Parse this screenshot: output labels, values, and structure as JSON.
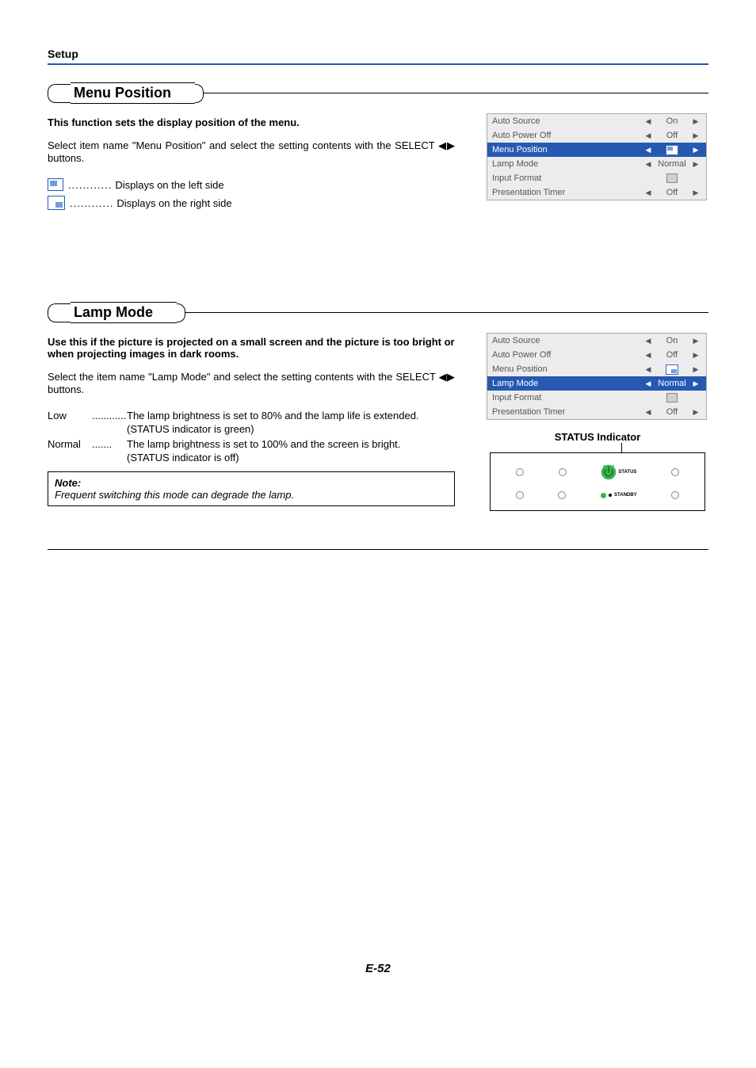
{
  "header": {
    "section": "Setup"
  },
  "menu_position": {
    "title": "Menu Position",
    "intro_bold": "This function sets the display position of the menu.",
    "body": "Select item name \"Menu Position\" and select the setting contents with the SELECT ◀▶ buttons.",
    "legend_left": "Displays on the left side",
    "legend_right": "Displays on the right side",
    "panel": [
      {
        "label": "Auto Source",
        "value": "On",
        "left": true,
        "right": true,
        "highlight": false
      },
      {
        "label": "Auto Power Off",
        "value": "Off",
        "left": true,
        "right": true,
        "highlight": false
      },
      {
        "label": "Menu Position",
        "value": "icon-pos-left",
        "left": true,
        "right": true,
        "highlight": true
      },
      {
        "label": "Lamp Mode",
        "value": "Normal",
        "left": true,
        "right": true,
        "highlight": false
      },
      {
        "label": "Input Format",
        "value": "icon-enter",
        "left": false,
        "right": false,
        "highlight": false
      },
      {
        "label": "Presentation Timer",
        "value": "Off",
        "left": true,
        "right": true,
        "highlight": false
      }
    ]
  },
  "lamp_mode": {
    "title": "Lamp Mode",
    "intro_bold": "Use this if the picture is projected on a small screen and the picture is too bright or when projecting images in dark rooms.",
    "body": "Select the item name \"Lamp Mode\" and select the setting contents with the SELECT ◀▶ buttons.",
    "low_label": "Low",
    "low_desc": "The lamp brightness is set to 80% and the lamp life is extended.",
    "low_sub": "(STATUS indicator is green)",
    "normal_label": "Normal",
    "normal_desc": "The lamp brightness is set to 100% and the screen is bright.",
    "normal_sub": "(STATUS indicator is off)",
    "note_label": "Note:",
    "note_body": "Frequent switching this mode can degrade the lamp.",
    "panel": [
      {
        "label": "Auto Source",
        "value": "On",
        "left": true,
        "right": true,
        "highlight": false
      },
      {
        "label": "Auto Power Off",
        "value": "Off",
        "left": true,
        "right": true,
        "highlight": false
      },
      {
        "label": "Menu Position",
        "value": "icon-pos-right",
        "left": true,
        "right": true,
        "highlight": false
      },
      {
        "label": "Lamp Mode",
        "value": "Normal",
        "left": true,
        "right": true,
        "highlight": true
      },
      {
        "label": "Input Format",
        "value": "icon-enter",
        "left": false,
        "right": false,
        "highlight": false
      },
      {
        "label": "Presentation Timer",
        "value": "Off",
        "left": true,
        "right": true,
        "highlight": false
      }
    ],
    "status_caption": "STATUS Indicator",
    "status_label": "STATUS",
    "standby_label": "STANDBY"
  },
  "page_no": "E-52",
  "dots": "............"
}
